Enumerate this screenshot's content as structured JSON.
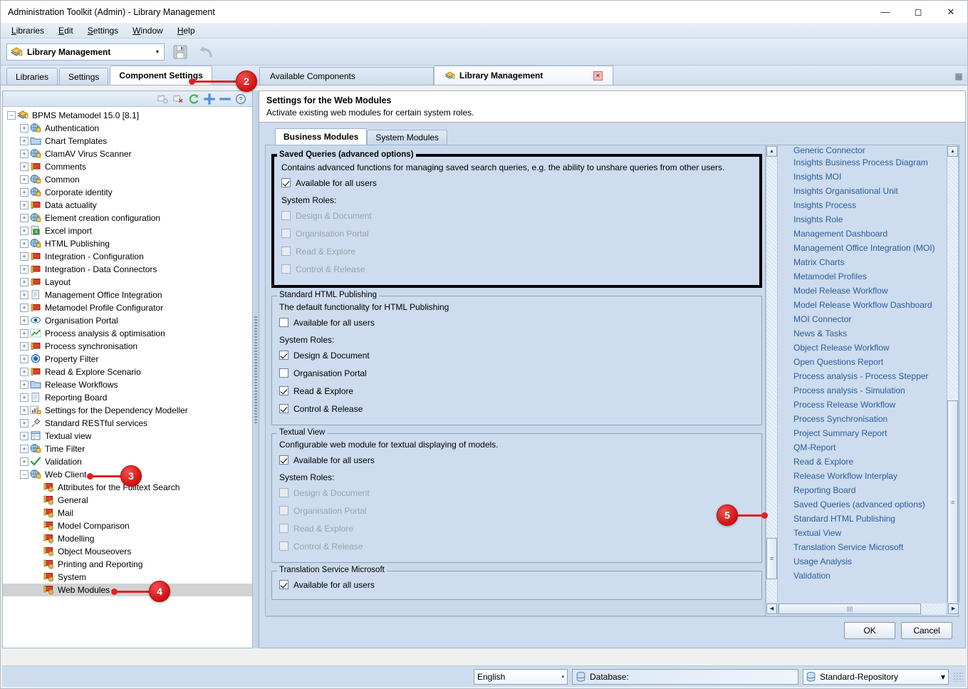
{
  "window": {
    "title": "Administration Toolkit (Admin) - Library Management",
    "minimize": "—",
    "maximize": "☐",
    "close": "✕"
  },
  "menubar": [
    {
      "label": "Libraries"
    },
    {
      "label": "Edit"
    },
    {
      "label": "Settings"
    },
    {
      "label": "Window"
    },
    {
      "label": "Help"
    }
  ],
  "toolbar": {
    "library_combo_value": "Library Management",
    "combo_arrow": "▾",
    "save_icon": "save-icon",
    "undo_icon": "undo-icon"
  },
  "main_tabs": [
    {
      "label": "Libraries",
      "active": false
    },
    {
      "label": "Settings",
      "active": false
    },
    {
      "label": "Component Settings",
      "active": true
    }
  ],
  "document_tabs": [
    {
      "label": "Available Components",
      "active": false,
      "closable": false
    },
    {
      "label": "Library Management",
      "active": true,
      "closable": true,
      "close_glyph": "×"
    }
  ],
  "tree": {
    "toolbar_icons": [
      "expand-node-icon",
      "collapse-node-icon",
      "refresh-icon",
      "add-icon",
      "remove-icon",
      "help-icon"
    ],
    "root": "BPMS Metamodel 15.0 [8.1]",
    "items": [
      {
        "label": "Authentication",
        "icon": "globe-lock-icon",
        "indent": 1,
        "expander": "+"
      },
      {
        "label": "Chart Templates",
        "icon": "folder-icon",
        "indent": 1,
        "expander": "+"
      },
      {
        "label": "ClamAV Virus Scanner",
        "icon": "globe-lock-icon",
        "indent": 1,
        "expander": "+"
      },
      {
        "label": "Comments",
        "icon": "red-book-icon",
        "indent": 1,
        "expander": "+"
      },
      {
        "label": "Common",
        "icon": "globe-lock-icon",
        "indent": 1,
        "expander": "+"
      },
      {
        "label": "Corporate identity",
        "icon": "globe-lock-icon",
        "indent": 1,
        "expander": "+"
      },
      {
        "label": "Data actuality",
        "icon": "red-book-icon",
        "indent": 1,
        "expander": "+"
      },
      {
        "label": "Element creation configuration",
        "icon": "globe-lock-icon",
        "indent": 1,
        "expander": "+"
      },
      {
        "label": "Excel import",
        "icon": "excel-icon",
        "indent": 1,
        "expander": "+"
      },
      {
        "label": "HTML Publishing",
        "icon": "globe-lock-icon",
        "indent": 1,
        "expander": "+"
      },
      {
        "label": "Integration - Configuration",
        "icon": "red-book-icon",
        "indent": 1,
        "expander": "+"
      },
      {
        "label": "Integration - Data Connectors",
        "icon": "red-book-icon",
        "indent": 1,
        "expander": "+"
      },
      {
        "label": "Layout",
        "icon": "red-book-icon",
        "indent": 1,
        "expander": "+"
      },
      {
        "label": "Management Office Integration",
        "icon": "document-icon",
        "indent": 1,
        "expander": "+"
      },
      {
        "label": "Metamodel Profile Configurator",
        "icon": "red-book-icon",
        "indent": 1,
        "expander": "+"
      },
      {
        "label": "Organisation Portal",
        "icon": "eye-icon",
        "indent": 1,
        "expander": "+"
      },
      {
        "label": "Process analysis & optimisation",
        "icon": "chart-line-icon",
        "indent": 1,
        "expander": "+"
      },
      {
        "label": "Process synchronisation",
        "icon": "red-book-icon",
        "indent": 1,
        "expander": "+"
      },
      {
        "label": "Property Filter",
        "icon": "blue-circle-icon",
        "indent": 1,
        "expander": "+"
      },
      {
        "label": "Read & Explore Scenario",
        "icon": "red-book-icon",
        "indent": 1,
        "expander": "+"
      },
      {
        "label": "Release Workflows",
        "icon": "folder-icon",
        "indent": 1,
        "expander": "+"
      },
      {
        "label": "Reporting Board",
        "icon": "document-icon",
        "indent": 1,
        "expander": "+"
      },
      {
        "label": "Settings for the Dependency Modeller",
        "icon": "bar-chart-lock-icon",
        "indent": 1,
        "expander": "+"
      },
      {
        "label": "Standard RESTful services",
        "icon": "plug-icon",
        "indent": 1,
        "expander": "+"
      },
      {
        "label": "Textual view",
        "icon": "table-icon",
        "indent": 1,
        "expander": "+"
      },
      {
        "label": "Time Filter",
        "icon": "globe-lock-icon",
        "indent": 1,
        "expander": "+"
      },
      {
        "label": "Validation",
        "icon": "green-check-icon",
        "indent": 1,
        "expander": "+"
      },
      {
        "label": "Web Client",
        "icon": "globe-lock-icon",
        "indent": 1,
        "expander": "-"
      },
      {
        "label": "Attributes for the Fulltext Search",
        "icon": "red-book-gear-icon",
        "indent": 2,
        "expander": ""
      },
      {
        "label": "General",
        "icon": "red-book-gear-icon",
        "indent": 2,
        "expander": ""
      },
      {
        "label": "Mail",
        "icon": "red-book-gear-icon",
        "indent": 2,
        "expander": ""
      },
      {
        "label": "Model Comparison",
        "icon": "red-book-gear-icon",
        "indent": 2,
        "expander": ""
      },
      {
        "label": "Modelling",
        "icon": "red-book-gear-icon",
        "indent": 2,
        "expander": ""
      },
      {
        "label": "Object Mouseovers",
        "icon": "red-book-gear-icon",
        "indent": 2,
        "expander": ""
      },
      {
        "label": "Printing and Reporting",
        "icon": "red-book-gear-icon",
        "indent": 2,
        "expander": ""
      },
      {
        "label": "System",
        "icon": "red-book-gear-icon",
        "indent": 2,
        "expander": ""
      },
      {
        "label": "Web Modules",
        "icon": "red-book-gear-icon",
        "indent": 2,
        "expander": "",
        "selected": true
      }
    ]
  },
  "panel": {
    "title": "Settings for the Web Modules",
    "subtitle": "Activate existing web modules for certain system roles.",
    "tabs": [
      {
        "label": "Business Modules",
        "active": true
      },
      {
        "label": "System Modules",
        "active": false
      }
    ]
  },
  "groups": [
    {
      "title": "Saved Queries (advanced options)",
      "highlighted": true,
      "description": "Contains advanced functions for managing saved search queries, e.g. the ability to unshare queries from other users.",
      "available_label": "Available for all users",
      "available_checked": true,
      "roles_header": "System Roles:",
      "roles": [
        {
          "label": "Design & Document",
          "checked": false,
          "disabled": true
        },
        {
          "label": "Organisation Portal",
          "checked": false,
          "disabled": true
        },
        {
          "label": "Read & Explore",
          "checked": false,
          "disabled": true
        },
        {
          "label": "Control & Release",
          "checked": false,
          "disabled": true
        }
      ]
    },
    {
      "title": "Standard HTML Publishing",
      "highlighted": false,
      "description": "The default functionality for HTML Publishing",
      "available_label": "Available for all users",
      "available_checked": false,
      "roles_header": "System Roles:",
      "roles": [
        {
          "label": "Design & Document",
          "checked": true,
          "disabled": false
        },
        {
          "label": "Organisation Portal",
          "checked": false,
          "disabled": false
        },
        {
          "label": "Read & Explore",
          "checked": true,
          "disabled": false
        },
        {
          "label": "Control & Release",
          "checked": true,
          "disabled": false
        }
      ]
    },
    {
      "title": "Textual View",
      "highlighted": false,
      "description": "Configurable web module for textual displaying of models.",
      "available_label": "Available for all users",
      "available_checked": true,
      "roles_header": "System Roles:",
      "roles": [
        {
          "label": "Design & Document",
          "checked": false,
          "disabled": true
        },
        {
          "label": "Organisation Portal",
          "checked": false,
          "disabled": true
        },
        {
          "label": "Read & Explore",
          "checked": false,
          "disabled": true
        },
        {
          "label": "Control & Release",
          "checked": false,
          "disabled": true
        }
      ]
    },
    {
      "title": "Translation Service Microsoft",
      "highlighted": false,
      "description": "",
      "available_label": "Available for all users",
      "available_checked": true,
      "roles_header": "",
      "roles": []
    }
  ],
  "module_list": {
    "partial_top": "Generic Connector",
    "items": [
      "Insights Business Process Diagram",
      "Insights MOI",
      "Insights Organisational Unit",
      "Insights Process",
      "Insights Role",
      "Management Dashboard",
      "Management Office Integration (MOI)",
      "Matrix Charts",
      "Metamodel Profiles",
      "Model Release Workflow",
      "Model Release Workflow Dashboard",
      "MOI Connector",
      "News & Tasks",
      "Object Release Workflow",
      "Open Questions Report",
      "Process analysis - Process Stepper",
      "Process analysis - Simulation",
      "Process Release Workflow",
      "Process Synchronisation",
      "Project Summary Report",
      "QM-Report",
      "Read & Explore",
      "Release Workflow Interplay",
      "Reporting Board",
      "Saved Queries (advanced options)",
      "Standard HTML Publishing",
      "Textual View",
      "Translation Service Microsoft",
      "Usage Analysis",
      "Validation"
    ],
    "scroll_up_glyph": "▲",
    "scroll_down_glyph": "▼",
    "scroll_left_glyph": "◀",
    "scroll_right_glyph": "▶"
  },
  "buttons": {
    "ok": "OK",
    "cancel": "Cancel"
  },
  "statusbar": {
    "language_value": "English",
    "language_arrow": "▾",
    "database_label": "Database:",
    "database_value": "",
    "repository_value": "Standard-Repository",
    "repository_arrow": "▾",
    "db_icon": "database-icon"
  },
  "callouts": [
    {
      "number": "2",
      "target": "component-settings-tab"
    },
    {
      "number": "3",
      "target": "tree-item-web-client"
    },
    {
      "number": "4",
      "target": "tree-item-web-modules"
    },
    {
      "number": "5",
      "target": "module-list-saved-queries"
    }
  ],
  "colors": {
    "accent_link": "#2a5d9e",
    "callout_red": "#e02020",
    "panel_blue": "#cddcee",
    "highlight_border": "#000000"
  }
}
